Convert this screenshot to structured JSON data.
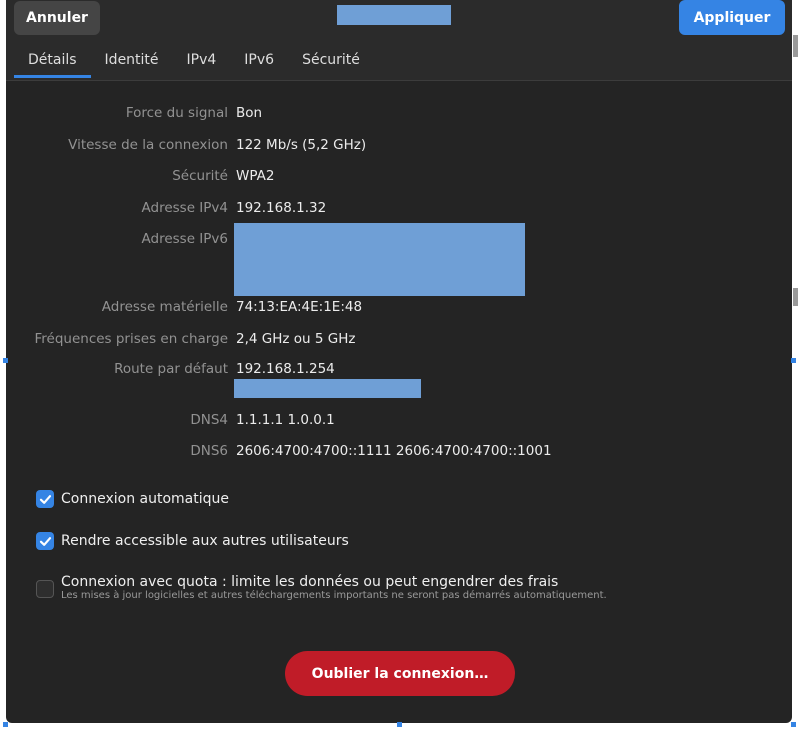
{
  "header": {
    "cancel_label": "Annuler",
    "apply_label": "Appliquer"
  },
  "tabs": [
    {
      "label": "Détails",
      "active": true
    },
    {
      "label": "Identité",
      "active": false
    },
    {
      "label": "IPv4",
      "active": false
    },
    {
      "label": "IPv6",
      "active": false
    },
    {
      "label": "Sécurité",
      "active": false
    }
  ],
  "details": [
    {
      "label": "Force du signal",
      "value": "Bon"
    },
    {
      "label": "Vitesse de la connexion",
      "value": "122 Mb/s (5,2 GHz)"
    },
    {
      "label": "Sécurité",
      "value": "WPA2"
    },
    {
      "label": "Adresse IPv4",
      "value": "192.168.1.32"
    },
    {
      "label": "Adresse IPv6",
      "value": ""
    },
    {
      "label": "Adresse matérielle",
      "value": "74:13:EA:4E:1E:48"
    },
    {
      "label": "Fréquences prises en charge",
      "value": "2,4 GHz ou 5 GHz"
    },
    {
      "label": "Route par défaut",
      "value": "192.168.1.254"
    },
    {
      "label": "DNS4",
      "value": "1.1.1.1 1.0.0.1"
    },
    {
      "label": "DNS6",
      "value": "2606:4700:4700::1111 2606:4700:4700::1001"
    }
  ],
  "options": {
    "auto_connect": {
      "label": "Connexion automatique",
      "checked": true
    },
    "share": {
      "label": "Rendre accessible aux autres utilisateurs",
      "checked": true
    },
    "metered": {
      "label": "Connexion avec quota : limite les données ou peut engendrer des frais",
      "sublabel": "Les mises à jour logicielles et autres téléchargements importants ne seront pas démarrés automatiquement.",
      "checked": false
    }
  },
  "forget_label": "Oublier la connexion…",
  "colors": {
    "accent": "#3584e4",
    "destructive": "#c01c28",
    "background": "#242424",
    "redaction": "#6f9fd6"
  }
}
